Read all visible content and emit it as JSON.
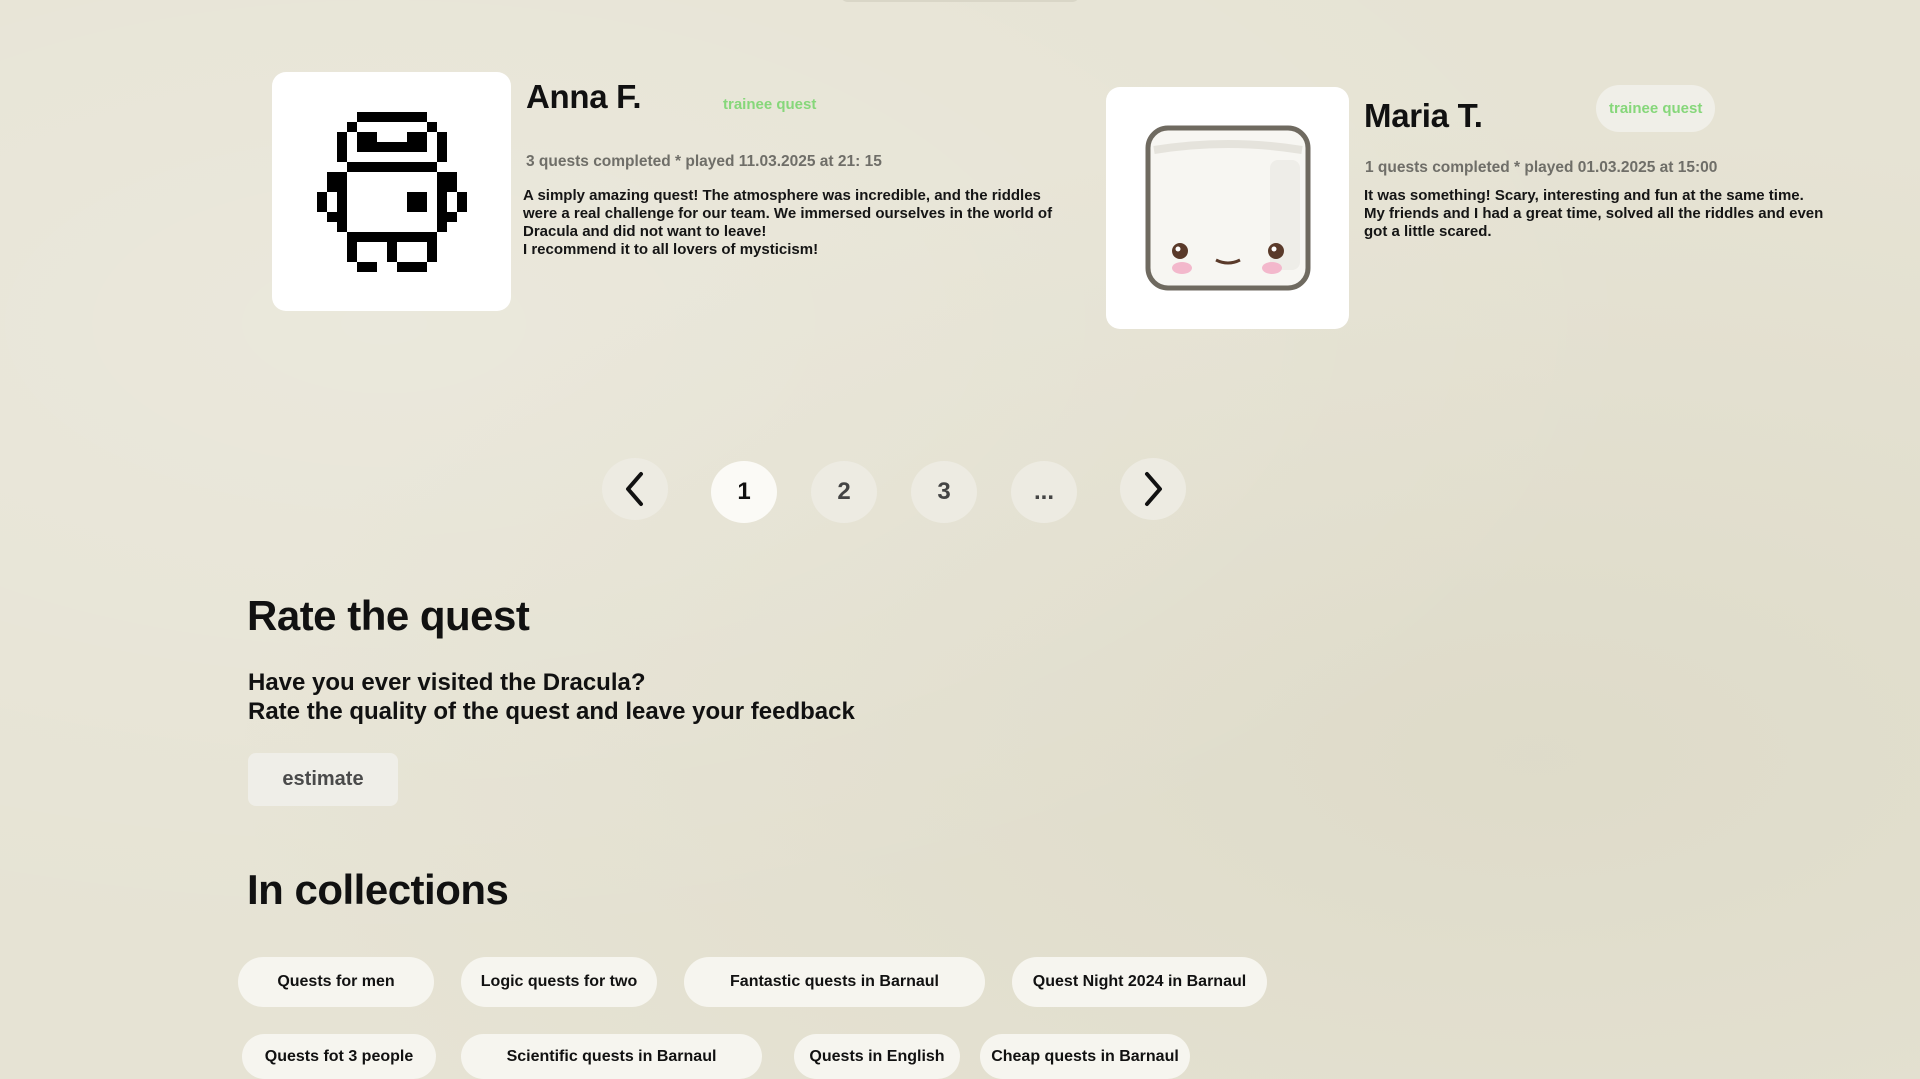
{
  "reviews": [
    {
      "name": "Anna F.",
      "badge": "trainee quest",
      "meta": "3 quests completed * played 11.03.2025 at 21: 15",
      "text": "A simply amazing quest! The atmosphere was incredible, and the riddles\nwere a real challenge for our team. We immersed ourselves in the world of\nDracula and did not want to leave!\nI recommend it to all lovers of mysticism!",
      "avatar": "pixel-robot-avatar"
    },
    {
      "name": "Maria T.",
      "badge": "trainee quest",
      "meta": "1 quests completed * played 01.03.2025 at 15:00",
      "text": "It was something! Scary, interesting and fun at the same time.\n My friends and I had a great time, solved all the riddles and even\ngot a little scared.",
      "avatar": "marshmallow-avatar"
    }
  ],
  "pagination": {
    "prev_icon": "chevron-left-icon",
    "pages": [
      "1",
      "2",
      "3",
      "..."
    ],
    "current": "1",
    "next_icon": "chevron-right-icon"
  },
  "rate": {
    "title": "Rate the quest",
    "line1": "Have you ever visited the Dracula?",
    "line2": "Rate the quality of the quest and leave your feedback",
    "button": "estimate"
  },
  "collections": {
    "title": "In collections",
    "items": [
      "Quests for men",
      "Logic quests for two",
      "Fantastic quests in Barnaul",
      "Quest Night 2024 in Barnaul",
      "Quests fot 3 people",
      "Scientific quests in Barnaul",
      "Quests in English",
      "Cheap quests in Barnaul"
    ]
  },
  "colors": {
    "background": "#e6e3d4",
    "badge_green": "#86d77a",
    "card_white": "#ffffff"
  }
}
